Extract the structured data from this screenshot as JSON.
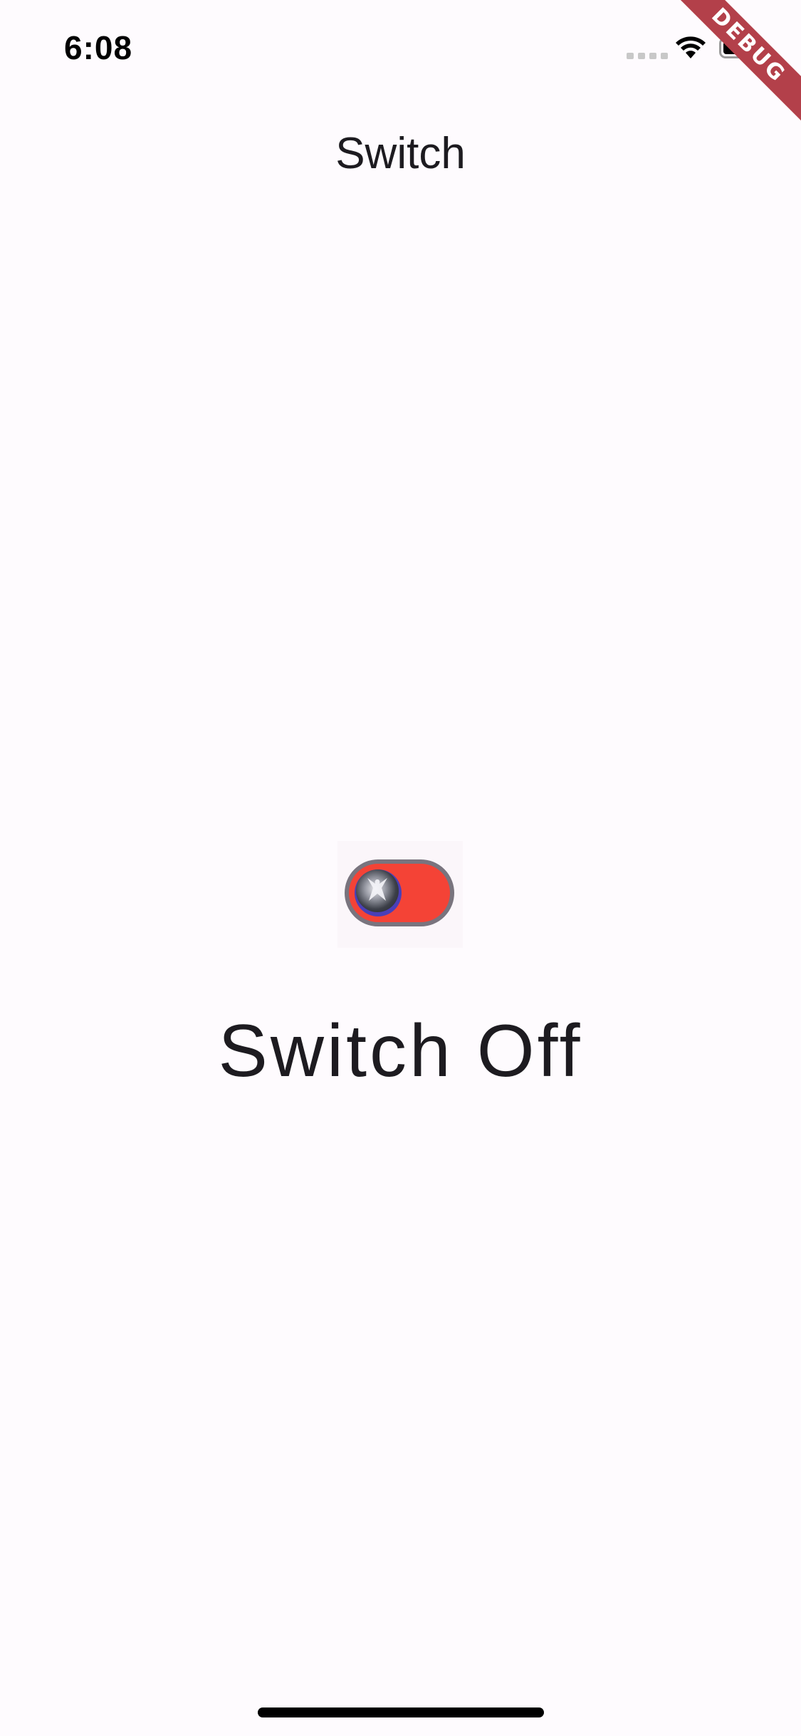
{
  "status_bar": {
    "time": "6:08",
    "icons": [
      "cellular-signal-icon",
      "wifi-icon",
      "battery-icon"
    ]
  },
  "debug_banner": {
    "label": "DEBUG"
  },
  "app_bar": {
    "title": "Switch"
  },
  "switch": {
    "state": "off",
    "track_color": "#f44336",
    "border_color": "#79747e",
    "thumb_color": "#4a3fb8"
  },
  "main": {
    "status_label": "Switch Off"
  },
  "colors": {
    "background": "#fefbfe",
    "text": "#1d1b20"
  }
}
